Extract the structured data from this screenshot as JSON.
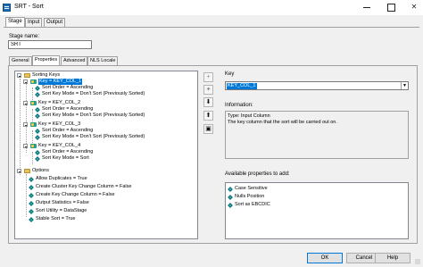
{
  "window": {
    "title": "SRT - Sort"
  },
  "top_tabs": [
    {
      "label": "Stage",
      "active": true
    },
    {
      "label": "Input",
      "active": false
    },
    {
      "label": "Output",
      "active": false
    }
  ],
  "stage": {
    "label": "Stage name:",
    "value": "SRT"
  },
  "sub_tabs": [
    {
      "label": "General",
      "active": false
    },
    {
      "label": "Properties",
      "active": true
    },
    {
      "label": "Advanced",
      "active": false
    },
    {
      "label": "NLS Locale",
      "active": false
    }
  ],
  "tree": {
    "sorting_keys_label": "Sorting Keys",
    "keys": [
      {
        "label": "Key = KEY_COL_1",
        "selected": true,
        "order": "Sort Order = Ascending",
        "mode": "Sort Key Mode = Don't Sort (Previously Sorted)"
      },
      {
        "label": "Key = KEY_COL_2",
        "selected": false,
        "order": "Sort Order = Ascending",
        "mode": "Sort Key Mode = Don't Sort (Previously Sorted)"
      },
      {
        "label": "Key = KEY_COL_3",
        "selected": false,
        "order": "Sort Order = Ascending",
        "mode": "Sort Key Mode = Don't Sort (Previously Sorted)"
      },
      {
        "label": "Key = KEY_COL_4",
        "selected": false,
        "order": "Sort Order = Ascending",
        "mode": "Sort Key Mode = Sort"
      }
    ],
    "options_label": "Options",
    "options": [
      "Allow Duplicates = True",
      "Create Cluster Key Change Column = False",
      "Create Key Change Column = False",
      "Output Statistics = False",
      "Sort Utility = DataStage",
      "Stable Sort = True"
    ]
  },
  "toolbar_icons": [
    "add-icon",
    "insert-icon",
    "move-down-icon",
    "move-up-icon",
    "delete-icon"
  ],
  "key_panel": {
    "label": "Key",
    "selected_value": "KEY_COL_1",
    "info_label": "Information:",
    "info_lines": [
      "Type: Input Column",
      "The key column that the sort will be carried out on."
    ]
  },
  "available": {
    "label": "Available properties to add:",
    "items": [
      "Case Sensitive",
      "Nulls Position",
      "Sort as EBCDIC"
    ]
  },
  "footer": {
    "ok": "OK",
    "cancel": "Cancel",
    "help": "Help"
  },
  "colors": {
    "selection": "#0078d7",
    "key_icon": "#2a9d8f",
    "folder_icon": "#e8c25a"
  }
}
